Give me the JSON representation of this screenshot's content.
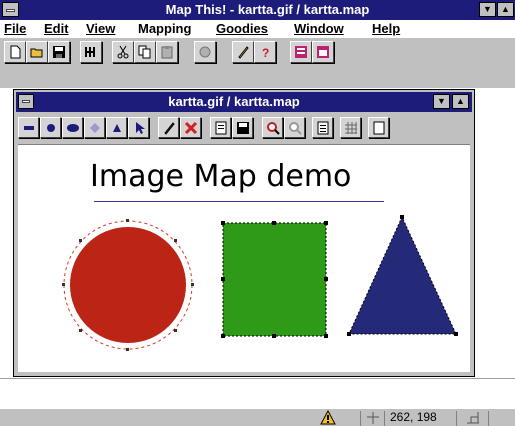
{
  "app": {
    "title": "Map This! - kartta.gif / kartta.map"
  },
  "menu": {
    "items": [
      "File",
      "Edit",
      "View",
      "Mapping",
      "Goodies",
      "Window",
      "Help"
    ]
  },
  "toolbar": {
    "icons": [
      "new-document-icon",
      "open-folder-icon",
      "save-disk-icon",
      "hex-edit-icon",
      "cut-icon",
      "copy-icon",
      "paste-icon",
      "image-icon",
      "pencil-icon",
      "help-icon",
      "grid-icon",
      "window-icon"
    ]
  },
  "child_window": {
    "title": "kartta.gif / kartta.map",
    "tools": [
      "rectangle-tool-icon",
      "circle-tool-icon",
      "ellipse-tool-icon",
      "polygon-tool-icon",
      "pin-tool-icon",
      "arrow-select-icon",
      "pencil-icon",
      "delete-icon",
      "properties-icon",
      "save-disk-icon",
      "zoom-in-icon",
      "zoom-out-icon",
      "document-icon",
      "grid-icon",
      "scroll-icon"
    ]
  },
  "canvas": {
    "heading": "Image Map demo",
    "colors": {
      "circle": "#bc2416",
      "square": "#2e9a18",
      "triangle": "#252a78",
      "selection_outline": "#d23a1c"
    }
  },
  "status": {
    "coordinates": "262, 198"
  }
}
